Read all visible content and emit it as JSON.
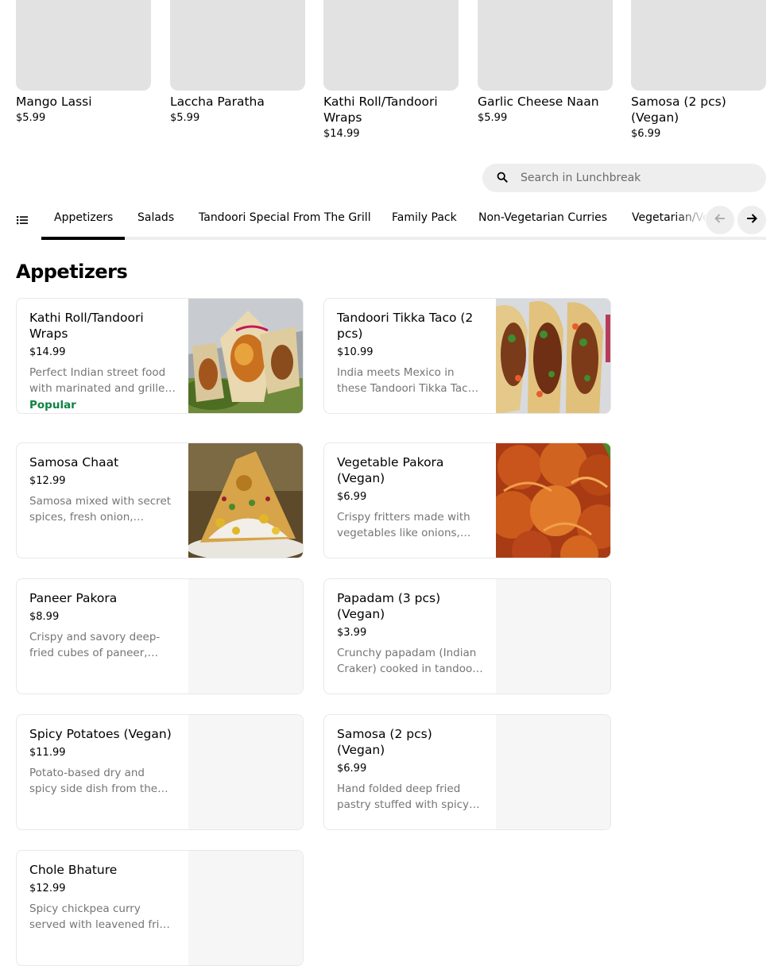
{
  "carousel": [
    {
      "name": "Mango Lassi",
      "price": "$5.99"
    },
    {
      "name": "Laccha Paratha",
      "price": "$5.99"
    },
    {
      "name": "Kathi Roll/Tandoori Wraps",
      "price": "$14.99"
    },
    {
      "name": "Garlic Cheese Naan",
      "price": "$5.99"
    },
    {
      "name": "Samosa (2 pcs) (Vegan)",
      "price": "$6.99"
    }
  ],
  "search": {
    "placeholder": "Search in Lunchbreak",
    "icon": "search-icon"
  },
  "categories": {
    "menu_icon": "list-icon",
    "active": "Appetizers",
    "tabs": [
      {
        "label": "Appetizers"
      },
      {
        "label": "Salads"
      },
      {
        "label": "Tandoori Special From The Grill"
      },
      {
        "label": "Family Pack"
      },
      {
        "label": "Non-Vegetarian Curries"
      },
      {
        "label": "Vegetarian/Vegan Curries"
      }
    ]
  },
  "section": {
    "title": "Appetizers",
    "items": [
      {
        "name": "Kathi Roll/Tandoori Wraps",
        "price": "$14.99",
        "description": "Perfect Indian street food with marinated and grilled paneer or chicken wrapped in paratha.",
        "badge": "Popular"
      },
      {
        "name": "Tandoori Tikka Taco (2 pcs)",
        "price": "$10.99",
        "description": "India meets Mexico in these Tandoori Tikka Tacos paired with fresh toppings.",
        "badge": ""
      },
      {
        "name": "Samosa Chaat",
        "price": "$12.99",
        "description": "Samosa mixed with secret spices, fresh onion, chutneys and yogurt.",
        "badge": ""
      },
      {
        "name": "Vegetable Pakora (Vegan)",
        "price": "$6.99",
        "description": "Crispy fritters made with vegetables like onions, potatoes and spinach.",
        "badge": ""
      },
      {
        "name": "Paneer Pakora",
        "price": "$8.99",
        "description": "Crispy and savory deep-fried cubes of paneer, coated in a spiced gram flour batter.",
        "badge": ""
      },
      {
        "name": "Papadam (3 pcs) (Vegan)",
        "price": "$3.99",
        "description": "Crunchy papadam (Indian Craker) cooked in tandoor oven.",
        "badge": ""
      },
      {
        "name": "Spicy Potatoes (Vegan)",
        "price": "$11.99",
        "description": "Potato-based dry and spicy side dish from the streets of India.",
        "badge": ""
      },
      {
        "name": "Samosa (2 pcs) (Vegan)",
        "price": "$6.99",
        "description": "Hand folded deep fried pastry stuffed with spicy potatoes and peas.",
        "badge": ""
      },
      {
        "name": "Chole Bhature",
        "price": "$12.99",
        "description": "Spicy chickpea curry served with leavened fried bread. Served with pickle and onions.",
        "badge": ""
      }
    ]
  },
  "colors": {
    "popular": "#0e8345",
    "accent": "#000000",
    "muted": "#757575"
  }
}
